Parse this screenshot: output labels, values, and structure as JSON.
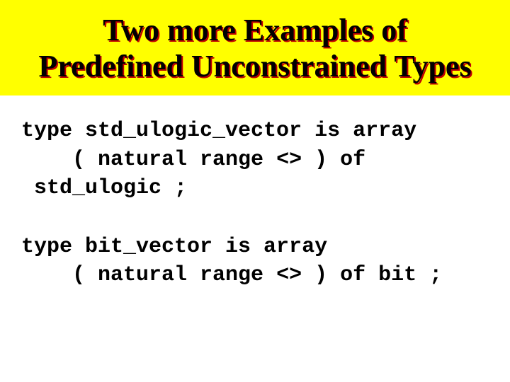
{
  "title_line1": "Two more Examples of",
  "title_line2": "Predefined Unconstrained Types",
  "code1_line1": "type std_ulogic_vector is array",
  "code1_line2": "    ( natural range <> ) of",
  "code1_line3": " std_ulogic ;",
  "code2_line1": "type bit_vector is array",
  "code2_line2": "    ( natural range <> ) of bit ;"
}
